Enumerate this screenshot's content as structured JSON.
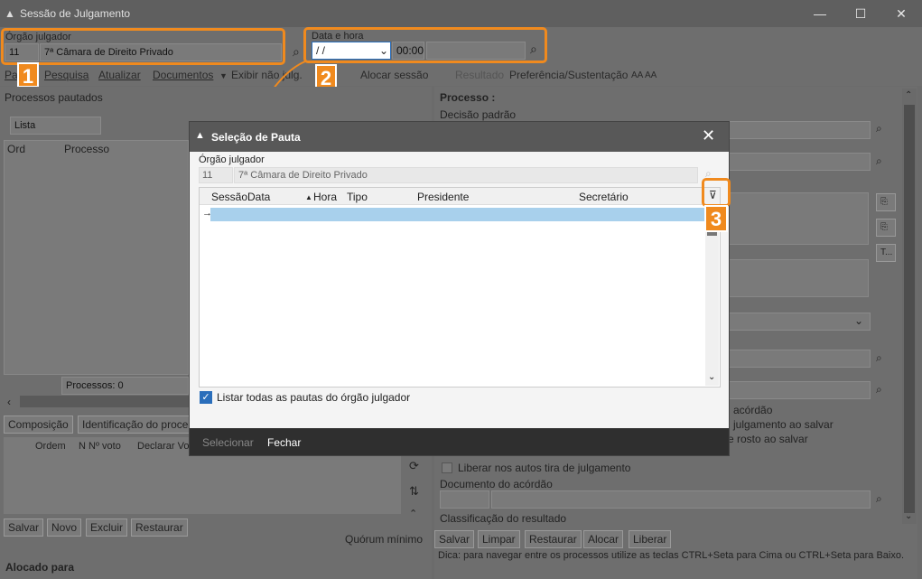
{
  "window": {
    "title": "Sessão de Julgamento",
    "min": "—",
    "max": "☐",
    "close": "✕"
  },
  "orgao": {
    "label": "Órgão julgador",
    "code": "11",
    "name": "7ª Câmara de Direito Privado"
  },
  "data_hora": {
    "label": "Data e hora",
    "date": " / /",
    "time": "00:00"
  },
  "toolbar": {
    "pauta": "Pa",
    "pesquisa": "Pesquisa",
    "atualizar": "Atualizar",
    "documentos": "Documentos",
    "exibir": "Exibir não julg.",
    "encerrar": "E...rar",
    "alocar": "Alocar sessão",
    "resultado": "Resultado",
    "preferencia": "Preferência/Sustentação",
    "fontsize": "AA AA"
  },
  "left": {
    "header": "Processos pautados",
    "lista": "Lista",
    "col_ord": "Ord",
    "col_processo": "Processo",
    "count": "Processos: 0",
    "tab_composicao": "Composição",
    "tab_identificacao": "Identificação do proce",
    "col_ordem": "Ordem",
    "col_nvoto": "N Nº voto",
    "col_declarar": "Declarar Vo",
    "btn_salvar": "Salvar",
    "btn_novo": "Novo",
    "btn_excluir": "Excluir",
    "btn_restaurar": "Restaurar",
    "quorum": "Quórum mínimo",
    "alocado": "Alocado para"
  },
  "right": {
    "processo": "Processo :",
    "decisao": "Decisão padrão",
    "acordao": "acórdão",
    "julgamento_salvar": "julgamento ao salvar",
    "rosto_salvar": "e rosto ao salvar",
    "liberar": "Liberar nos autos tira de julgamento",
    "documento": "Documento do acórdão",
    "classificacao": "Classificação do resultado",
    "btn_salvar": "Salvar",
    "btn_limpar": "Limpar",
    "btn_restaurar": "Restaurar",
    "btn_alocar": "Alocar",
    "btn_liberar": "Liberar",
    "dica": "Dica: para navegar entre os processos utilize as teclas CTRL+Seta para Cima ou CTRL+Seta para Baixo."
  },
  "dialog": {
    "title": "Seleção de Pauta",
    "orgao_label": "Órgão julgador",
    "code": "11",
    "name": "7ª Câmara de Direito Privado",
    "cols": {
      "sessao": "Sessão",
      "data": "Data",
      "hora": "Hora",
      "tipo": "Tipo",
      "presidente": "Presidente",
      "secretario": "Secretário"
    },
    "row_arrow": "→",
    "checkbox_label": "Listar todas as pautas do órgão julgador",
    "checkbox_checked": true,
    "btn_selecionar": "Selecionar",
    "btn_fechar": "Fechar"
  },
  "badges": {
    "b1": "1",
    "b2": "2",
    "b3": "3"
  },
  "colors": {
    "accent": "#f08a1e",
    "selection": "#a8d0ec",
    "checkbox": "#2a6ebb"
  }
}
